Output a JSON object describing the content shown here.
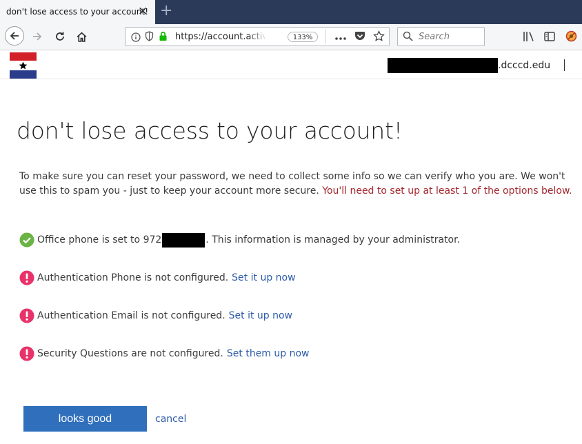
{
  "browser": {
    "tab_title": "don't lose access to your account!",
    "tab_close": "✕",
    "new_tab": "+",
    "url": "https://account.activ",
    "zoom": "133%",
    "search_placeholder": "Search"
  },
  "header": {
    "domain_suffix": ".dcccd.edu",
    "divider": "|"
  },
  "page": {
    "title": "don't lose access to your account!",
    "intro_text": "To make sure you can reset your password, we need to collect some info so we can verify who you are. We won't use this to spam you - just to keep your account more secure. ",
    "intro_warning": "You'll need to set up at least 1 of the options below.",
    "office_phone_prefix": "Office phone is set to 972",
    "office_phone_suffix": ". This information is managed by your administrator.",
    "items": [
      {
        "text": "Authentication Phone is not configured.",
        "link": "Set it up now"
      },
      {
        "text": "Authentication Email is not configured.",
        "link": "Set it up now"
      },
      {
        "text": "Security Questions are not configured.",
        "link": "Set them up now"
      }
    ],
    "primary_button": "looks good",
    "cancel_link": "cancel"
  },
  "colors": {
    "tab_strip": "#2c3a59",
    "primary": "#2f6fbb",
    "link": "#2b5aa8",
    "warning": "#a4262c",
    "success": "#6ab344",
    "error": "#e8336a"
  }
}
